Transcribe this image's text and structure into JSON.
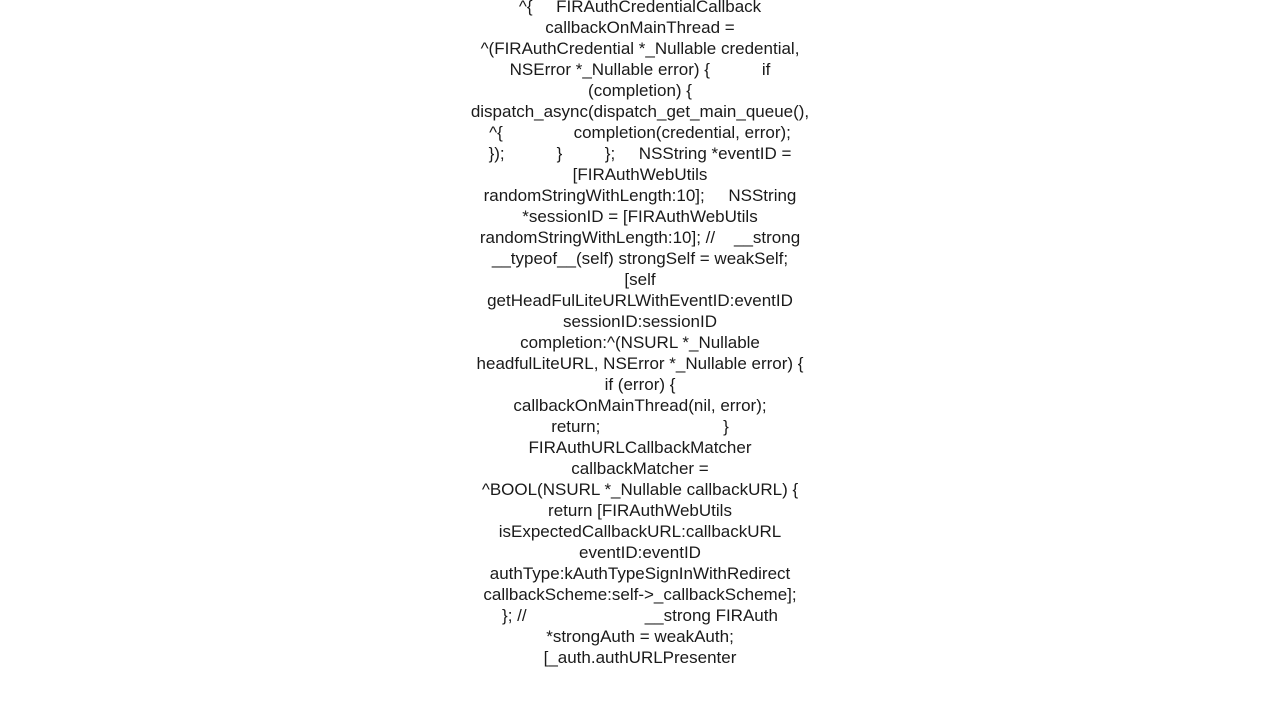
{
  "code_block": "^{     FIRAuthCredentialCallback callbackOnMainThread =         ^(FIRAuthCredential *_Nullable credential, NSError *_Nullable error) {           if (completion) {             dispatch_async(dispatch_get_main_queue(), ^{               completion(credential, error);             });           }         };     NSString *eventID = [FIRAuthWebUtils randomStringWithLength:10];     NSString *sessionID = [FIRAuthWebUtils randomStringWithLength:10]; //    __strong __typeof__(self) strongSelf = weakSelf;     [self      getHeadFulLiteURLWithEventID:eventID                         sessionID:sessionID                        completion:^(NSURL *_Nullable headfulLiteURL, NSError *_Nullable error) {                          if (error) {                            callbackOnMainThread(nil, error);                            return;                          }                          FIRAuthURLCallbackMatcher callbackMatcher =                              ^BOOL(NSURL *_Nullable callbackURL) {                                return [FIRAuthWebUtils                                    isExpectedCallbackURL:callbackURL                                                  eventID:eventID                                                 authType:kAuthTypeSignInWithRedirect                                           callbackScheme:self->_callbackScheme];                              }; //                         __strong FIRAuth *strongAuth = weakAuth;                          [_auth.authURLPresenter"
}
